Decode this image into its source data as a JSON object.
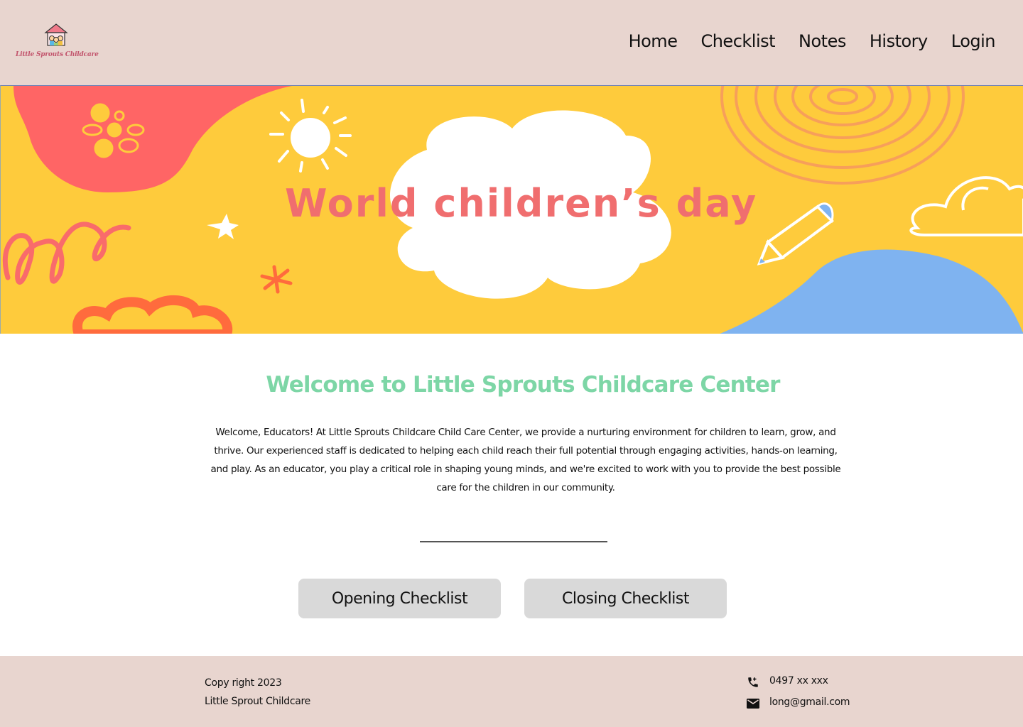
{
  "header": {
    "logo_text": "Little Sprouts Childcare",
    "nav": [
      "Home",
      "Checklist",
      "Notes",
      "History",
      "Login"
    ]
  },
  "banner": {
    "title": "World children’s day",
    "colors": {
      "background": "#fecb3c",
      "title": "#f06e6f",
      "blob_red": "#ff6565",
      "blob_blue": "#7fb3f0",
      "spiral": "#f79f5a"
    }
  },
  "main": {
    "title": "Welcome to Little Sprouts Childcare Center",
    "text": "Welcome, Educators! At Little Sprouts Childcare Child Care Center,  we provide a nurturing environment for children to learn, grow, and thrive. Our experienced staff is dedicated to helping each child reach their full potential through engaging activities, hands-on learning, and play. As an educator, you play a critical role in shaping young minds, and we're excited to work with you to provide the best possible care for the children in our community.",
    "buttons": {
      "opening": "Opening Checklist",
      "closing": "Closing Checklist"
    }
  },
  "footer": {
    "copyright": "Copy right 2023",
    "org": "Little Sprout Childcare",
    "phone": "0497 xx xxx",
    "email": "long@gmail.com",
    "icons": {
      "phone": "phone-icon",
      "email": "mail-icon"
    }
  }
}
